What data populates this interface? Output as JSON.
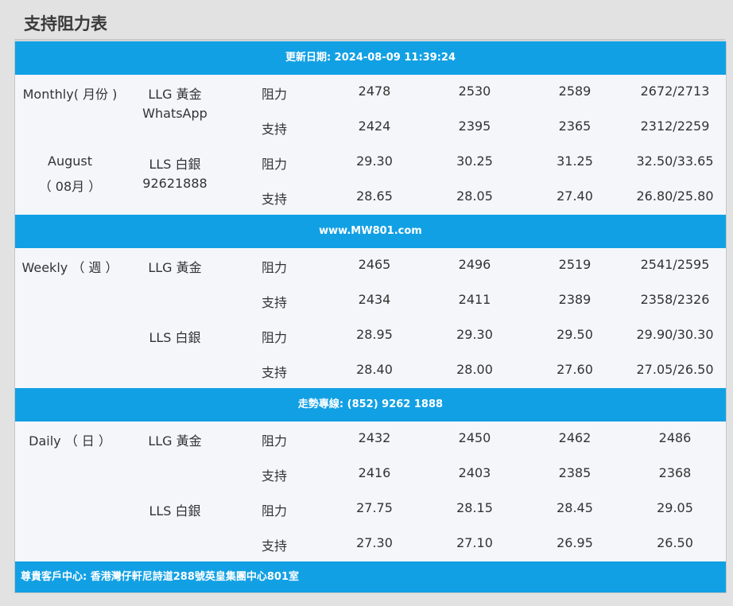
{
  "title": "支持阻力表",
  "update_banner": "更新日期: 2024-08-09 11:39:24",
  "website_banner": "www.MW801.com",
  "hotline_banner": "走勢專線: (852) 9262 1888",
  "footer_banner": "尊貴客戶中心: 香港灣仔軒尼詩道288號英皇集團中心801室",
  "monthly": {
    "period_line1": "Monthly( 月份 )",
    "period_line2": "August",
    "period_line3": "（ 08月 ）",
    "gold_label": "LLG 黃金",
    "gold_sub": "WhatsApp",
    "silver_label": "LLS 白銀",
    "silver_sub": "92621888",
    "rows": [
      {
        "type": "阻力",
        "v": [
          "2478",
          "2530",
          "2589",
          "2672/2713"
        ]
      },
      {
        "type": "支持",
        "v": [
          "2424",
          "2395",
          "2365",
          "2312/2259"
        ]
      },
      {
        "type": "阻力",
        "v": [
          "29.30",
          "30.25",
          "31.25",
          "32.50/33.65"
        ]
      },
      {
        "type": "支持",
        "v": [
          "28.65",
          "28.05",
          "27.40",
          "26.80/25.80"
        ]
      }
    ]
  },
  "weekly": {
    "period_line1": "Weekly （ 週 ）",
    "gold_label": "LLG 黃金",
    "silver_label": "LLS 白銀",
    "rows": [
      {
        "type": "阻力",
        "v": [
          "2465",
          "2496",
          "2519",
          "2541/2595"
        ]
      },
      {
        "type": "支持",
        "v": [
          "2434",
          "2411",
          "2389",
          "2358/2326"
        ]
      },
      {
        "type": "阻力",
        "v": [
          "28.95",
          "29.30",
          "29.50",
          "29.90/30.30"
        ]
      },
      {
        "type": "支持",
        "v": [
          "28.40",
          "28.00",
          "27.60",
          "27.05/26.50"
        ]
      }
    ]
  },
  "daily": {
    "period_line1": "Daily （ 日 ）",
    "gold_label": "LLG 黃金",
    "silver_label": "LLS 白銀",
    "rows": [
      {
        "type": "阻力",
        "v": [
          "2432",
          "2450",
          "2462",
          "2486"
        ]
      },
      {
        "type": "支持",
        "v": [
          "2416",
          "2403",
          "2385",
          "2368"
        ]
      },
      {
        "type": "阻力",
        "v": [
          "27.75",
          "28.15",
          "28.45",
          "29.05"
        ]
      },
      {
        "type": "支持",
        "v": [
          "27.30",
          "27.10",
          "26.95",
          "26.50"
        ]
      }
    ]
  }
}
